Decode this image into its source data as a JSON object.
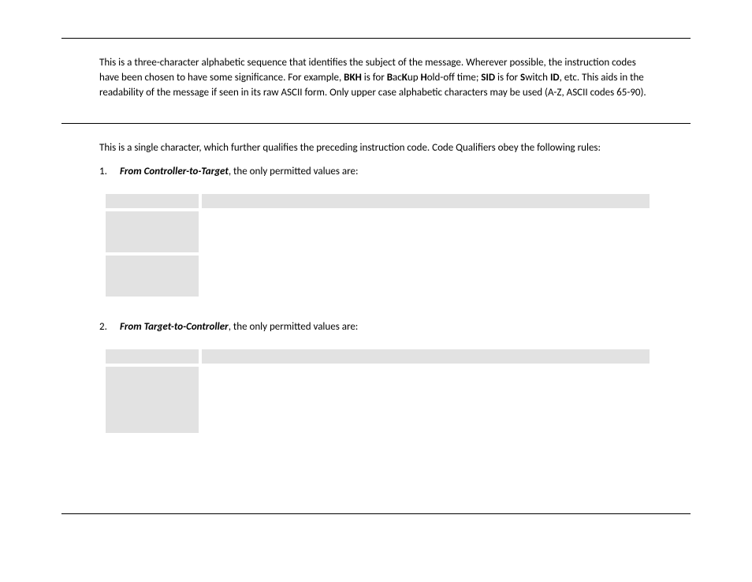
{
  "section1": {
    "paragraph_parts": [
      "This is a three-character alphabetic sequence that identifies the subject of the message. Wherever possible, the instruction codes have been chosen to have some significance. For example, ",
      "BKH",
      " is for ",
      "B",
      "ac",
      "K",
      "up ",
      "H",
      "old-off time; ",
      "SID",
      " is for ",
      "S",
      "witch ",
      "ID",
      ", etc. This aids in the readability of the message if seen in its raw ASCII form. Only upper case alphabetic characters may be used (A-Z, ASCII codes 65-90)."
    ]
  },
  "section2": {
    "intro": "This is a single character, which further qualifies the preceding instruction code. Code Qualifiers obey the following rules:",
    "item1": {
      "num": "1.",
      "lead": "From Controller-to-Target",
      "rest": ", the only permitted values are:"
    },
    "item2": {
      "num": "2.",
      "lead": "From Target-to-Controller",
      "rest": ", the only permitted values are:"
    }
  }
}
